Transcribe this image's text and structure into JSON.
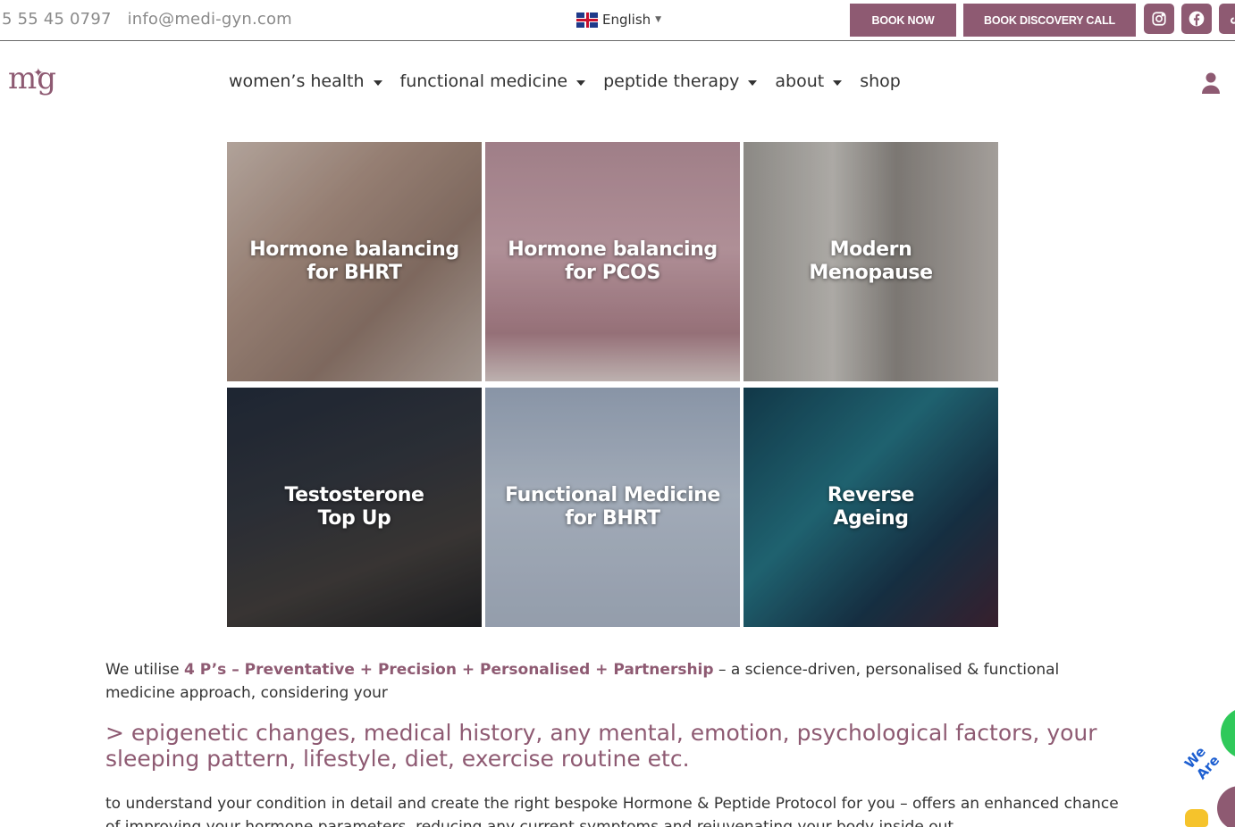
{
  "topbar": {
    "phone": "5 55 45 0797",
    "email": "info@medi-gyn.com",
    "language": "English",
    "book_now": "BOOK NOW",
    "book_call": "BOOK DISCOVERY CALL",
    "social_icons": [
      "instagram-icon",
      "facebook-icon",
      "tiktok-icon"
    ]
  },
  "logo": {
    "text": "mg"
  },
  "nav": {
    "items": [
      {
        "label": "women’s health",
        "dropdown": true
      },
      {
        "label": "functional medicine",
        "dropdown": true
      },
      {
        "label": "peptide therapy",
        "dropdown": true
      },
      {
        "label": "about",
        "dropdown": true
      },
      {
        "label": "shop",
        "dropdown": false
      }
    ]
  },
  "tiles": [
    {
      "title": "Hormone balancing\nfor BHRT"
    },
    {
      "title": "Hormone balancing\nfor PCOS"
    },
    {
      "title": "Modern\nMenopause"
    },
    {
      "title": "Testosterone\nTop Up"
    },
    {
      "title": "Functional Medicine\nfor BHRT"
    },
    {
      "title": "Reverse\nAgeing"
    }
  ],
  "content": {
    "intro_before": "We utilise ",
    "intro_highlight": "4 P’s – Preventative + Precision + Personalised + Partnership",
    "intro_after": " – a science-driven, personalised & functional medicine approach, considering your",
    "factors": "> epigenetic changes, medical history, any mental, emotion, psychological factors, your sleeping pattern, lifestyle, diet, exercise routine etc.",
    "conclusion": "to understand your condition in detail and create the right bespoke Hormone & Peptide Protocol for you – offers an enhanced chance of improving your hormone parameters, reducing any current symptoms and rejuvenating your body inside out."
  },
  "widget": {
    "badge_text": "We Are"
  },
  "colors": {
    "brand": "#8e5a72",
    "whatsapp": "#2fc95a"
  }
}
